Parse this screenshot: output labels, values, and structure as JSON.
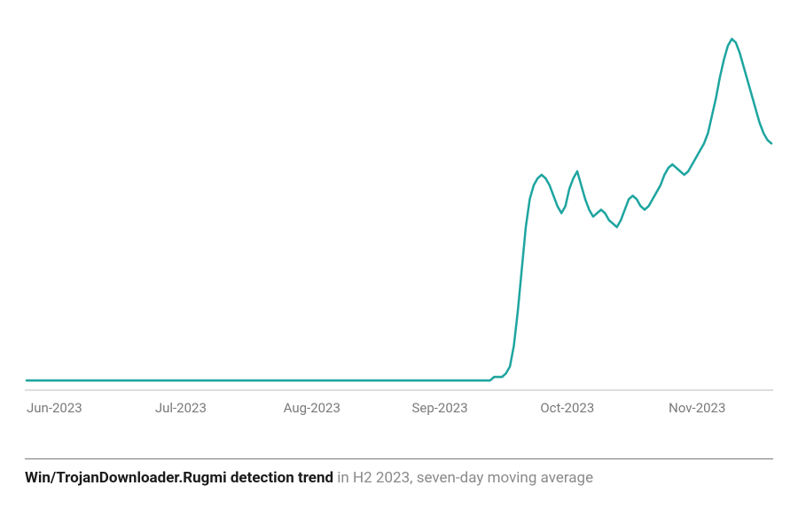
{
  "chart_data": {
    "type": "line",
    "title": "",
    "xlabel": "",
    "ylabel": "",
    "ylim": [
      0,
      105
    ],
    "x_ticks": [
      "Jun-2023",
      "Jul-2023",
      "Aug-2023",
      "Sep-2023",
      "Oct-2023",
      "Nov-2023"
    ],
    "series": [
      {
        "name": "Win/TrojanDownloader.Rugmi",
        "color": "#1ea5a0",
        "values": [
          2,
          2,
          2,
          2,
          2,
          2,
          2,
          2,
          2,
          2,
          2,
          2,
          2,
          2,
          2,
          2,
          2,
          2,
          2,
          2,
          2,
          2,
          2,
          2,
          2,
          2,
          2,
          2,
          2,
          2,
          2,
          2,
          2,
          2,
          2,
          2,
          2,
          2,
          2,
          2,
          2,
          2,
          2,
          2,
          2,
          2,
          2,
          2,
          2,
          2,
          2,
          2,
          2,
          2,
          2,
          2,
          2,
          2,
          2,
          2,
          2,
          2,
          2,
          2,
          2,
          2,
          2,
          2,
          2,
          2,
          2,
          2,
          2,
          2,
          2,
          2,
          2,
          2,
          2,
          2,
          2,
          2,
          2,
          2,
          2,
          2,
          2,
          2,
          2,
          2,
          2,
          2,
          2,
          2,
          2,
          2,
          2,
          2,
          2,
          2,
          2,
          2,
          2,
          2,
          2,
          2,
          2,
          2,
          2,
          2,
          2,
          2,
          2,
          2,
          2,
          2,
          2,
          2,
          3,
          3,
          3,
          4,
          6,
          12,
          22,
          34,
          46,
          54,
          58,
          60,
          61,
          60,
          58,
          55,
          52,
          50,
          52,
          57,
          60,
          62,
          58,
          54,
          51,
          49,
          50,
          51,
          50,
          48,
          47,
          46,
          48,
          51,
          54,
          55,
          54,
          52,
          51,
          52,
          54,
          56,
          58,
          61,
          63,
          64,
          63,
          62,
          61,
          62,
          64,
          66,
          68,
          70,
          73,
          78,
          83,
          89,
          94,
          98,
          100,
          99,
          96,
          92,
          88,
          84,
          80,
          76,
          73,
          71,
          70
        ]
      }
    ]
  },
  "caption": {
    "bold": "Win/TrojanDownloader.Rugmi detection trend",
    "rest": " in H2 2023, seven-day moving average"
  },
  "x_labels": [
    "Jun-2023",
    "Jul-2023",
    "Aug-2023",
    "Sep-2023",
    "Oct-2023",
    "Nov-2023"
  ]
}
